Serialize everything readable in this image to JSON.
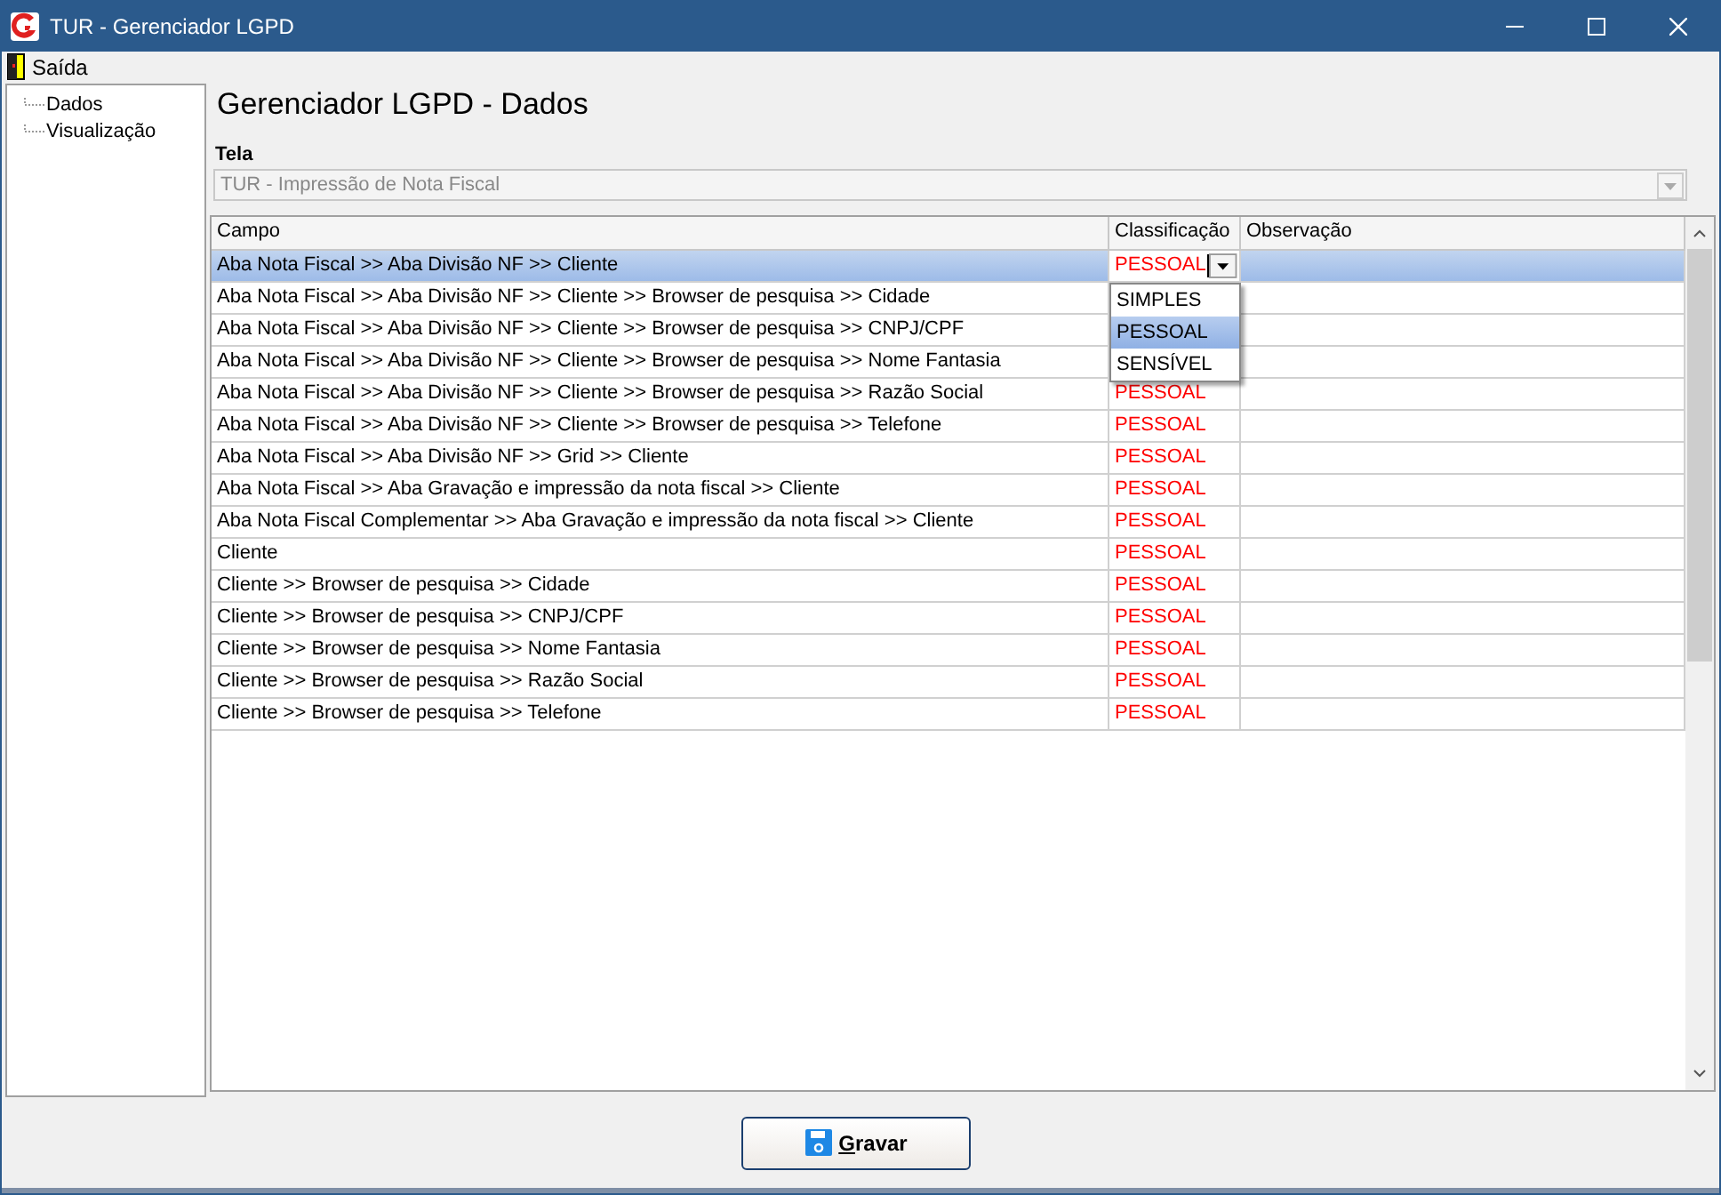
{
  "window": {
    "title": "TUR - Gerenciador LGPD"
  },
  "menu": [
    {
      "label": "Saída"
    }
  ],
  "tree": {
    "items": [
      {
        "label": "Dados"
      },
      {
        "label": "Visualização"
      }
    ]
  },
  "heading": "Gerenciador LGPD - Dados",
  "screen_field": {
    "label": "Tela",
    "value": "TUR - Impressão de Nota Fiscal",
    "disabled": true
  },
  "table": {
    "columns": [
      "Campo",
      "Classificação",
      "Observação"
    ],
    "rows": [
      {
        "campo": "Aba Nota Fiscal >> Aba Divisão NF >> Cliente",
        "classificacao": "PESSOAL",
        "selected": true,
        "editing": true
      },
      {
        "campo": "Aba Nota Fiscal >> Aba Divisão NF >> Cliente >> Browser de pesquisa >> Cidade",
        "selected": false
      },
      {
        "campo": "Aba Nota Fiscal >> Aba Divisão NF >> Cliente >> Browser de pesquisa >> CNPJ/CPF",
        "selected": false
      },
      {
        "campo": "Aba Nota Fiscal >> Aba Divisão NF >> Cliente >> Browser de pesquisa >> Nome Fantasia",
        "selected": false
      },
      {
        "campo": "Aba Nota Fiscal >> Aba Divisão NF >> Cliente >> Browser de pesquisa >> Razão Social",
        "classificacao": "PESSOAL",
        "selected": false
      },
      {
        "campo": "Aba Nota Fiscal >> Aba Divisão NF >> Cliente >> Browser de pesquisa >> Telefone",
        "classificacao": "PESSOAL",
        "selected": false
      },
      {
        "campo": "Aba Nota Fiscal >> Aba Divisão NF >> Grid >> Cliente",
        "classificacao": "PESSOAL",
        "selected": false
      },
      {
        "campo": "Aba Nota Fiscal >> Aba Gravação e impressão da nota fiscal >> Cliente",
        "classificacao": "PESSOAL",
        "selected": false
      },
      {
        "campo": "Aba Nota Fiscal Complementar >> Aba Gravação e impressão da nota fiscal >> Cliente",
        "classificacao": "PESSOAL",
        "selected": false
      },
      {
        "campo": "Cliente",
        "classificacao": "PESSOAL",
        "selected": false
      },
      {
        "campo": "Cliente >> Browser de pesquisa >> Cidade",
        "classificacao": "PESSOAL",
        "selected": false
      },
      {
        "campo": "Cliente >> Browser de pesquisa >> CNPJ/CPF",
        "classificacao": "PESSOAL",
        "selected": false
      },
      {
        "campo": "Cliente >> Browser de pesquisa >> Nome Fantasia",
        "classificacao": "PESSOAL",
        "selected": false
      },
      {
        "campo": "Cliente >> Browser de pesquisa >> Razão Social",
        "classificacao": "PESSOAL",
        "selected": false
      },
      {
        "campo": "Cliente >> Browser de pesquisa >> Telefone",
        "classificacao": "PESSOAL",
        "selected": false
      }
    ]
  },
  "dropdown": {
    "options": [
      {
        "label": "SIMPLES",
        "selected": false
      },
      {
        "label": "PESSOAL",
        "selected": true
      },
      {
        "label": "SENSÍVEL",
        "selected": false
      }
    ]
  },
  "buttons": [
    {
      "label": "Gravar"
    }
  ]
}
